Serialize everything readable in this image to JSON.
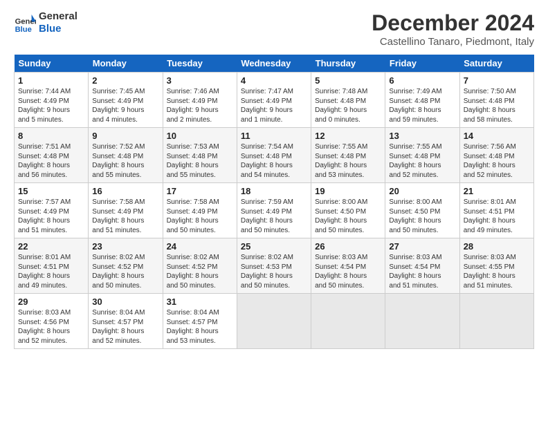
{
  "header": {
    "logo_line1": "General",
    "logo_line2": "Blue",
    "month_title": "December 2024",
    "location": "Castellino Tanaro, Piedmont, Italy"
  },
  "days_of_week": [
    "Sunday",
    "Monday",
    "Tuesday",
    "Wednesday",
    "Thursday",
    "Friday",
    "Saturday"
  ],
  "weeks": [
    [
      {
        "day": "1",
        "info": "Sunrise: 7:44 AM\nSunset: 4:49 PM\nDaylight: 9 hours\nand 5 minutes."
      },
      {
        "day": "2",
        "info": "Sunrise: 7:45 AM\nSunset: 4:49 PM\nDaylight: 9 hours\nand 4 minutes."
      },
      {
        "day": "3",
        "info": "Sunrise: 7:46 AM\nSunset: 4:49 PM\nDaylight: 9 hours\nand 2 minutes."
      },
      {
        "day": "4",
        "info": "Sunrise: 7:47 AM\nSunset: 4:49 PM\nDaylight: 9 hours\nand 1 minute."
      },
      {
        "day": "5",
        "info": "Sunrise: 7:48 AM\nSunset: 4:48 PM\nDaylight: 9 hours\nand 0 minutes."
      },
      {
        "day": "6",
        "info": "Sunrise: 7:49 AM\nSunset: 4:48 PM\nDaylight: 8 hours\nand 59 minutes."
      },
      {
        "day": "7",
        "info": "Sunrise: 7:50 AM\nSunset: 4:48 PM\nDaylight: 8 hours\nand 58 minutes."
      }
    ],
    [
      {
        "day": "8",
        "info": "Sunrise: 7:51 AM\nSunset: 4:48 PM\nDaylight: 8 hours\nand 56 minutes."
      },
      {
        "day": "9",
        "info": "Sunrise: 7:52 AM\nSunset: 4:48 PM\nDaylight: 8 hours\nand 55 minutes."
      },
      {
        "day": "10",
        "info": "Sunrise: 7:53 AM\nSunset: 4:48 PM\nDaylight: 8 hours\nand 55 minutes."
      },
      {
        "day": "11",
        "info": "Sunrise: 7:54 AM\nSunset: 4:48 PM\nDaylight: 8 hours\nand 54 minutes."
      },
      {
        "day": "12",
        "info": "Sunrise: 7:55 AM\nSunset: 4:48 PM\nDaylight: 8 hours\nand 53 minutes."
      },
      {
        "day": "13",
        "info": "Sunrise: 7:55 AM\nSunset: 4:48 PM\nDaylight: 8 hours\nand 52 minutes."
      },
      {
        "day": "14",
        "info": "Sunrise: 7:56 AM\nSunset: 4:48 PM\nDaylight: 8 hours\nand 52 minutes."
      }
    ],
    [
      {
        "day": "15",
        "info": "Sunrise: 7:57 AM\nSunset: 4:49 PM\nDaylight: 8 hours\nand 51 minutes."
      },
      {
        "day": "16",
        "info": "Sunrise: 7:58 AM\nSunset: 4:49 PM\nDaylight: 8 hours\nand 51 minutes."
      },
      {
        "day": "17",
        "info": "Sunrise: 7:58 AM\nSunset: 4:49 PM\nDaylight: 8 hours\nand 50 minutes."
      },
      {
        "day": "18",
        "info": "Sunrise: 7:59 AM\nSunset: 4:49 PM\nDaylight: 8 hours\nand 50 minutes."
      },
      {
        "day": "19",
        "info": "Sunrise: 8:00 AM\nSunset: 4:50 PM\nDaylight: 8 hours\nand 50 minutes."
      },
      {
        "day": "20",
        "info": "Sunrise: 8:00 AM\nSunset: 4:50 PM\nDaylight: 8 hours\nand 50 minutes."
      },
      {
        "day": "21",
        "info": "Sunrise: 8:01 AM\nSunset: 4:51 PM\nDaylight: 8 hours\nand 49 minutes."
      }
    ],
    [
      {
        "day": "22",
        "info": "Sunrise: 8:01 AM\nSunset: 4:51 PM\nDaylight: 8 hours\nand 49 minutes."
      },
      {
        "day": "23",
        "info": "Sunrise: 8:02 AM\nSunset: 4:52 PM\nDaylight: 8 hours\nand 50 minutes."
      },
      {
        "day": "24",
        "info": "Sunrise: 8:02 AM\nSunset: 4:52 PM\nDaylight: 8 hours\nand 50 minutes."
      },
      {
        "day": "25",
        "info": "Sunrise: 8:02 AM\nSunset: 4:53 PM\nDaylight: 8 hours\nand 50 minutes."
      },
      {
        "day": "26",
        "info": "Sunrise: 8:03 AM\nSunset: 4:54 PM\nDaylight: 8 hours\nand 50 minutes."
      },
      {
        "day": "27",
        "info": "Sunrise: 8:03 AM\nSunset: 4:54 PM\nDaylight: 8 hours\nand 51 minutes."
      },
      {
        "day": "28",
        "info": "Sunrise: 8:03 AM\nSunset: 4:55 PM\nDaylight: 8 hours\nand 51 minutes."
      }
    ],
    [
      {
        "day": "29",
        "info": "Sunrise: 8:03 AM\nSunset: 4:56 PM\nDaylight: 8 hours\nand 52 minutes."
      },
      {
        "day": "30",
        "info": "Sunrise: 8:04 AM\nSunset: 4:57 PM\nDaylight: 8 hours\nand 52 minutes."
      },
      {
        "day": "31",
        "info": "Sunrise: 8:04 AM\nSunset: 4:57 PM\nDaylight: 8 hours\nand 53 minutes."
      },
      {
        "day": "",
        "info": ""
      },
      {
        "day": "",
        "info": ""
      },
      {
        "day": "",
        "info": ""
      },
      {
        "day": "",
        "info": ""
      }
    ]
  ]
}
